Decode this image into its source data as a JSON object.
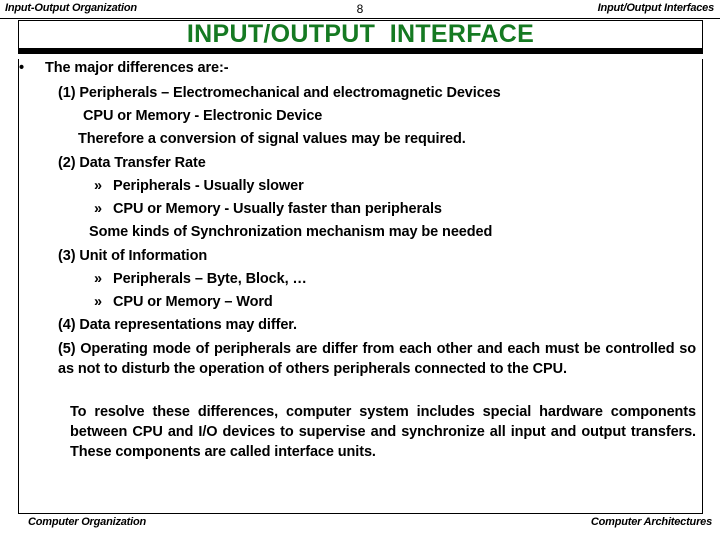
{
  "header": {
    "left": "Input-Output Organization",
    "page_number": "8",
    "right": "Input/Output Interfaces"
  },
  "title": {
    "text": "INPUT/OUTPUT  INTERFACE",
    "color": "#157a22"
  },
  "body": {
    "bullet_glyph": "•",
    "sub_bullet_glyph": "»",
    "lines": [
      {
        "id": "intro",
        "text": "The major differences are:-"
      },
      {
        "id": "item1",
        "text": "(1) Peripherals – Electromechanical and electromagnetic  Devices"
      },
      {
        "id": "item1b",
        "text": "CPU or Memory - Electronic Device"
      },
      {
        "id": "item1c",
        "text": "Therefore a conversion of signal values may be required."
      },
      {
        "id": "item2",
        "text": "(2) Data Transfer Rate"
      },
      {
        "id": "item2a",
        "text": "Peripherals - Usually slower"
      },
      {
        "id": "item2b",
        "text": "CPU or Memory - Usually faster than peripherals"
      },
      {
        "id": "item2c",
        "text": "Some kinds of Synchronization mechanism may be needed"
      },
      {
        "id": "item3",
        "text": "(3) Unit of Information"
      },
      {
        "id": "item3a",
        "text": "Peripherals – Byte, Block, …"
      },
      {
        "id": "item3b",
        "text": "CPU or Memory – Word"
      },
      {
        "id": "item4",
        "text": "(4) Data representations may differ."
      }
    ],
    "para5": "(5) Operating mode of peripherals are differ from each other and each must be controlled so as not to disturb the operation of others peripherals connected to the CPU.",
    "para6": "To resolve these differences, computer system includes special hardware components between CPU and I/O devices to supervise and synchronize all input and output transfers. These components are called interface units."
  },
  "footer": {
    "left": "Computer Organization",
    "right": "Computer Architectures"
  }
}
